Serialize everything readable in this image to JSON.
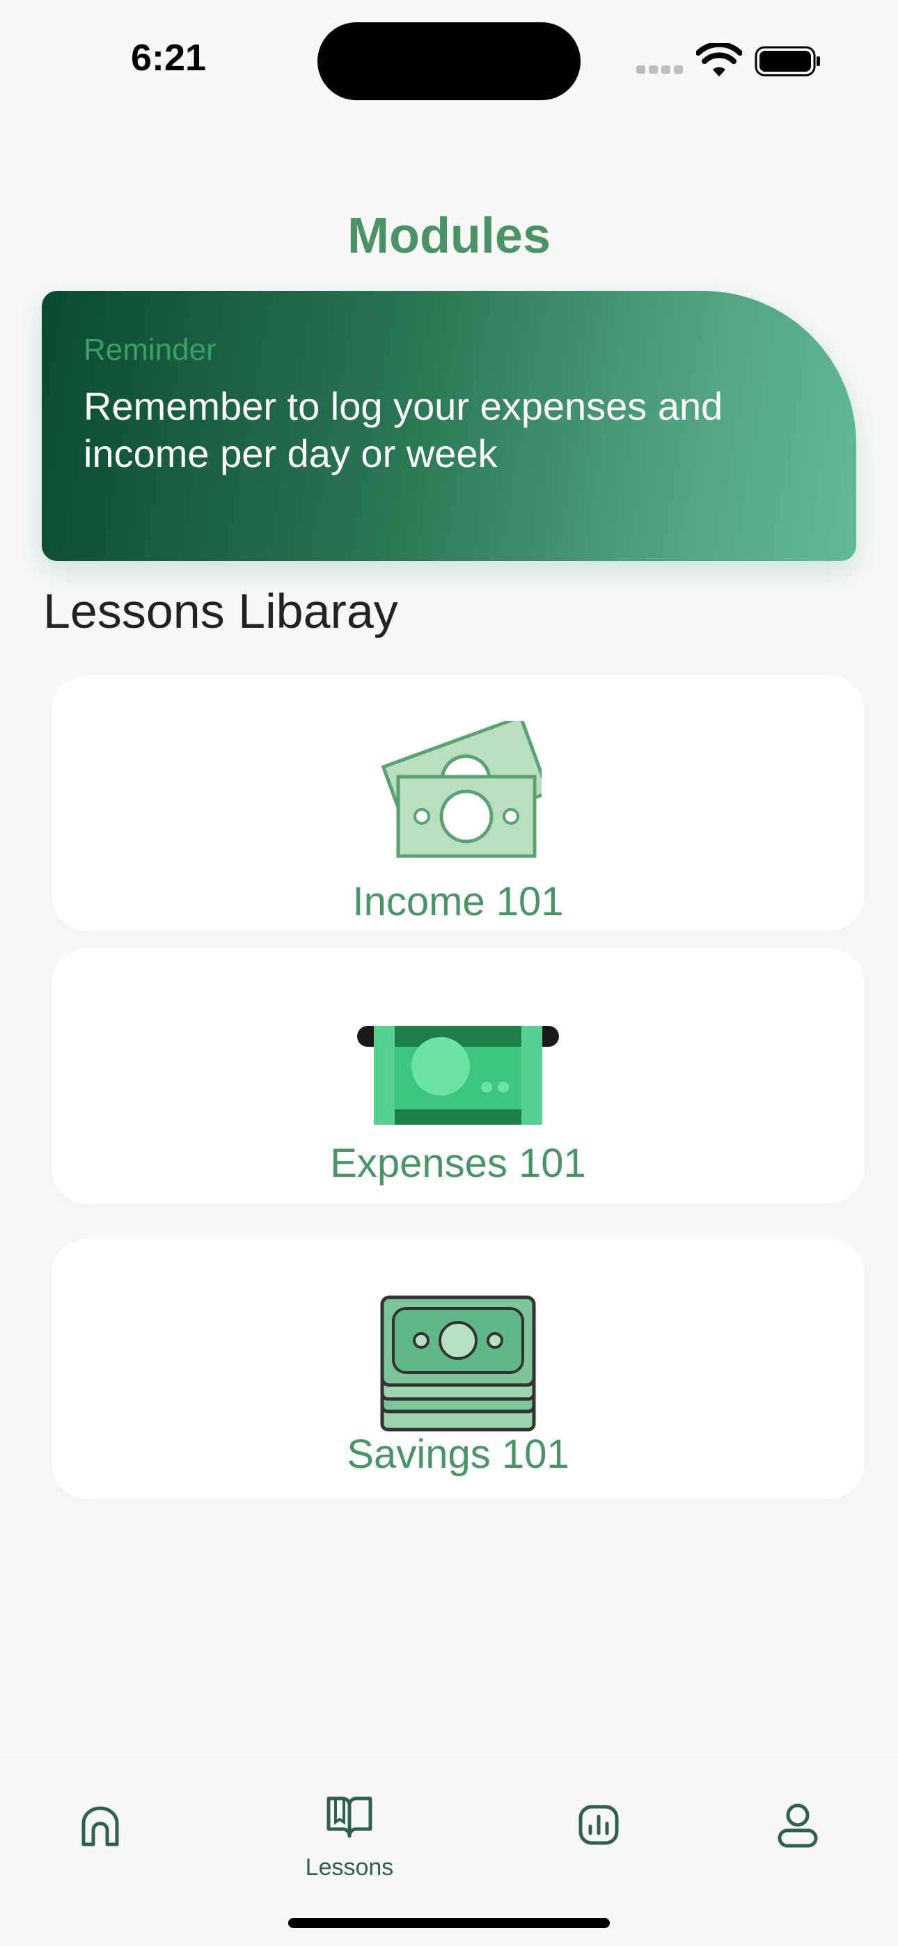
{
  "status_bar": {
    "time": "6:21"
  },
  "page": {
    "title": "Modules"
  },
  "reminder": {
    "label": "Reminder",
    "text": "Remember to log your expenses and income per day or week"
  },
  "library": {
    "heading": "Lessons Libaray",
    "lessons": [
      {
        "label": "Income 101",
        "icon": "money-bills-icon"
      },
      {
        "label": "Expenses 101",
        "icon": "cash-dispense-icon"
      },
      {
        "label": "Savings 101",
        "icon": "money-stack-icon"
      }
    ]
  },
  "nav": {
    "items": [
      {
        "icon": "home-icon",
        "label": ""
      },
      {
        "icon": "book-icon",
        "label": "Lessons"
      },
      {
        "icon": "chart-icon",
        "label": ""
      },
      {
        "icon": "user-icon",
        "label": ""
      }
    ]
  },
  "colors": {
    "accent": "#4a9367",
    "reminder_dark": "#0a4a32",
    "reminder_light": "#62bb96",
    "nav_icon": "#2f5f4d"
  }
}
